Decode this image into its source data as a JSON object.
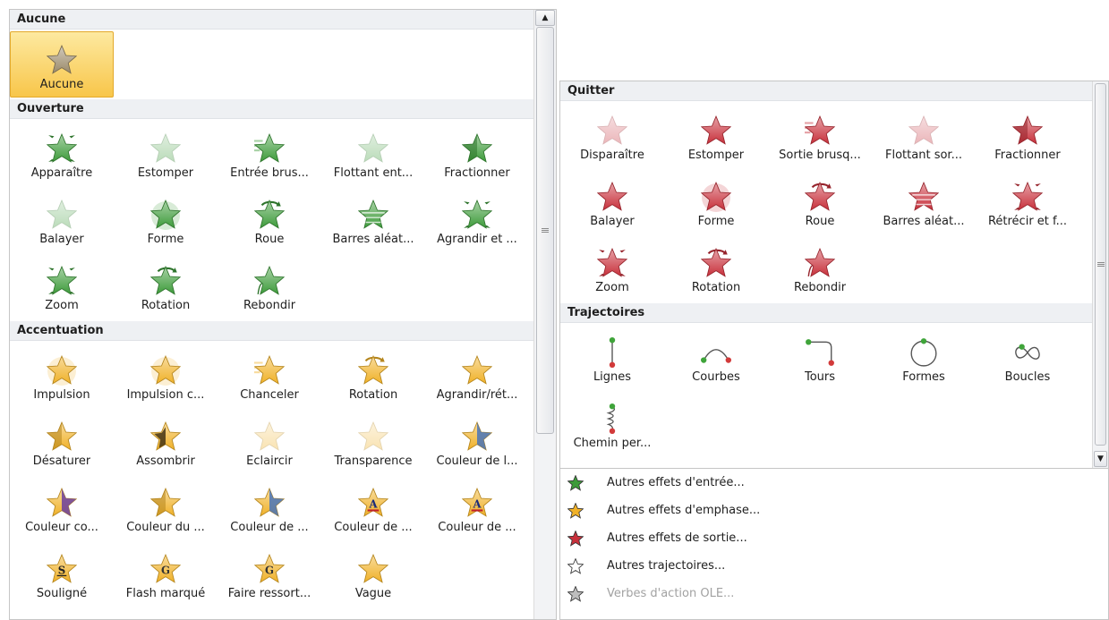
{
  "left_panel": {
    "sections": [
      {
        "title": "Aucune",
        "items": [
          {
            "label": "Aucune",
            "icon": "star-none-icon",
            "selected": true
          }
        ]
      },
      {
        "title": "Ouverture",
        "items": [
          {
            "label": "Apparaître",
            "icon": "star-appear-icon"
          },
          {
            "label": "Estomper",
            "icon": "star-fade-icon"
          },
          {
            "label": "Entrée brus...",
            "icon": "star-fly-in-icon"
          },
          {
            "label": "Flottant ent...",
            "icon": "star-float-in-icon"
          },
          {
            "label": "Fractionner",
            "icon": "star-split-icon"
          },
          {
            "label": "Balayer",
            "icon": "star-wipe-icon"
          },
          {
            "label": "Forme",
            "icon": "star-shape-icon"
          },
          {
            "label": "Roue",
            "icon": "star-wheel-icon"
          },
          {
            "label": "Barres aléat...",
            "icon": "star-random-bars-icon"
          },
          {
            "label": "Agrandir et ...",
            "icon": "star-grow-turn-icon"
          },
          {
            "label": "Zoom",
            "icon": "star-zoom-icon"
          },
          {
            "label": "Rotation",
            "icon": "star-swivel-icon"
          },
          {
            "label": "Rebondir",
            "icon": "star-bounce-icon"
          }
        ]
      },
      {
        "title": "Accentuation",
        "items": [
          {
            "label": "Impulsion",
            "icon": "star-pulse-icon"
          },
          {
            "label": "Impulsion c...",
            "icon": "star-color-pulse-icon"
          },
          {
            "label": "Chanceler",
            "icon": "star-teeter-icon"
          },
          {
            "label": "Rotation",
            "icon": "star-spin-icon"
          },
          {
            "label": "Agrandir/rét...",
            "icon": "star-grow-shrink-icon"
          },
          {
            "label": "Désaturer",
            "icon": "star-desaturate-icon"
          },
          {
            "label": "Assombrir",
            "icon": "star-darken-icon"
          },
          {
            "label": "Éclaircir",
            "icon": "star-lighten-icon"
          },
          {
            "label": "Transparence",
            "icon": "star-transparency-icon"
          },
          {
            "label": "Couleur de l...",
            "icon": "star-object-color-icon"
          },
          {
            "label": "Couleur co...",
            "icon": "star-complementary-color-icon"
          },
          {
            "label": "Couleur du ...",
            "icon": "star-line-color-icon"
          },
          {
            "label": "Couleur de ...",
            "icon": "star-fill-color-icon"
          },
          {
            "label": "Couleur de ...",
            "icon": "star-brush-color-icon"
          },
          {
            "label": "Couleur de ...",
            "icon": "star-font-color-icon"
          },
          {
            "label": "Souligné",
            "icon": "star-underline-icon"
          },
          {
            "label": "Flash marqué",
            "icon": "star-bold-flash-icon"
          },
          {
            "label": "Faire ressort...",
            "icon": "star-bold-reveal-icon"
          },
          {
            "label": "Vague",
            "icon": "star-wave-icon"
          }
        ]
      }
    ]
  },
  "right_panel": {
    "sections": [
      {
        "title": "Quitter",
        "items": [
          {
            "label": "Disparaître",
            "icon": "star-disappear-icon"
          },
          {
            "label": "Estomper",
            "icon": "star-fade-out-icon"
          },
          {
            "label": "Sortie brusq...",
            "icon": "star-fly-out-icon"
          },
          {
            "label": "Flottant sor...",
            "icon": "star-float-out-icon"
          },
          {
            "label": "Fractionner",
            "icon": "star-split-out-icon"
          },
          {
            "label": "Balayer",
            "icon": "star-wipe-out-icon"
          },
          {
            "label": "Forme",
            "icon": "star-shape-out-icon"
          },
          {
            "label": "Roue",
            "icon": "star-wheel-out-icon"
          },
          {
            "label": "Barres aléat...",
            "icon": "star-random-bars-out-icon"
          },
          {
            "label": "Rétrécir et f...",
            "icon": "star-shrink-turn-icon"
          },
          {
            "label": "Zoom",
            "icon": "star-zoom-out-icon"
          },
          {
            "label": "Rotation",
            "icon": "star-swivel-out-icon"
          },
          {
            "label": "Rebondir",
            "icon": "star-bounce-out-icon"
          }
        ]
      },
      {
        "title": "Trajectoires",
        "items": [
          {
            "label": "Lignes",
            "icon": "path-lines-icon"
          },
          {
            "label": "Courbes",
            "icon": "path-arcs-icon"
          },
          {
            "label": "Tours",
            "icon": "path-turns-icon"
          },
          {
            "label": "Formes",
            "icon": "path-shapes-icon"
          },
          {
            "label": "Boucles",
            "icon": "path-loops-icon"
          },
          {
            "label": "Chemin per...",
            "icon": "path-custom-icon"
          }
        ]
      }
    ],
    "menu": [
      {
        "label": "Autres effets d'entrée...",
        "icon": "entrance-effects-icon",
        "enabled": true
      },
      {
        "label": "Autres effets d'emphase...",
        "icon": "emphasis-effects-icon",
        "enabled": true
      },
      {
        "label": "Autres effets de sortie...",
        "icon": "exit-effects-icon",
        "enabled": true
      },
      {
        "label": "Autres trajectoires...",
        "icon": "motion-paths-icon",
        "enabled": true
      },
      {
        "label": "Verbes d'action OLE...",
        "icon": "ole-action-icon",
        "enabled": false
      }
    ]
  },
  "colors": {
    "entrance": "#3d9b3a",
    "emphasis": "#f0b127",
    "exit": "#c8303b",
    "none": "#9a8a6a",
    "path_start": "#3fa43a",
    "path_end": "#d23a3a"
  }
}
